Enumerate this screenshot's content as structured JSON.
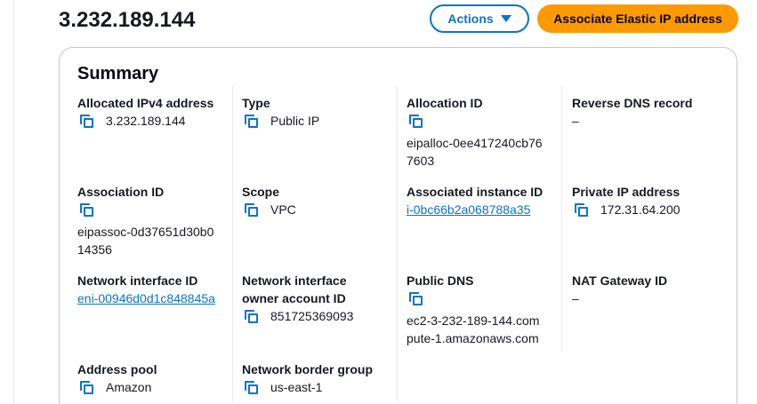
{
  "header": {
    "title": "3.232.189.144",
    "actions_label": "Actions",
    "associate_label": "Associate Elastic IP address"
  },
  "summary": {
    "title": "Summary",
    "fields": {
      "allocated_ipv4": {
        "label": "Allocated IPv4 address",
        "value": "3.232.189.144"
      },
      "type": {
        "label": "Type",
        "value": "Public IP"
      },
      "allocation_id": {
        "label": "Allocation ID",
        "value_line1": "eipalloc-0ee417240cb76",
        "value_line2": "7603"
      },
      "reverse_dns": {
        "label": "Reverse DNS record",
        "value": "–"
      },
      "association_id": {
        "label": "Association ID",
        "value_line1": "eipassoc-0d37651d30b0",
        "value_line2": "14356"
      },
      "scope": {
        "label": "Scope",
        "value": "VPC"
      },
      "associated_instance": {
        "label": "Associated instance ID",
        "value": "i-0bc66b2a068788a35"
      },
      "private_ip": {
        "label": "Private IP address",
        "value": "172.31.64.200"
      },
      "network_interface_id": {
        "label": "Network interface ID",
        "value": "eni-00946d0d1c848845a"
      },
      "ni_owner": {
        "label_line1": "Network interface",
        "label_line2": "owner account ID",
        "value": "851725369093"
      },
      "public_dns": {
        "label": "Public DNS",
        "value_line1": "ec2-3-232-189-144.com",
        "value_line2": "pute-1.amazonaws.com"
      },
      "nat_gateway": {
        "label": "NAT Gateway ID",
        "value": "–"
      },
      "address_pool": {
        "label": "Address pool",
        "value": "Amazon"
      },
      "border_group": {
        "label": "Network border group",
        "value": "us-east-1"
      }
    }
  },
  "icons": {
    "copy": "copy-icon",
    "caret": "caret-down-icon"
  },
  "colors": {
    "link": "#0972d3",
    "primary_button": "#ff9900",
    "text": "#16191f"
  }
}
